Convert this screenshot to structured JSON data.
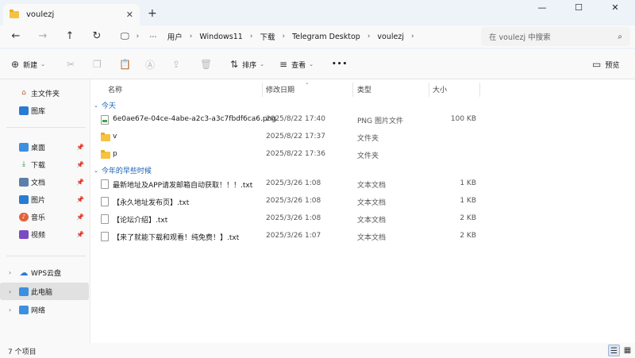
{
  "window": {
    "tab_title": "voulezj",
    "tab_close": "✕",
    "new_tab": "+",
    "minimize": "—",
    "maximize": "☐",
    "close": "✕"
  },
  "address": {
    "crumbs": [
      "用户",
      "Windows11",
      "下载",
      "Telegram Desktop",
      "voulezj"
    ],
    "more": "⋯",
    "sep": "›",
    "search_placeholder": "在 voulezj 中搜索"
  },
  "toolbar": {
    "new_label": "新建",
    "sort_label": "排序",
    "view_label": "查看",
    "more_label": "•••",
    "preview_label": "预览"
  },
  "sidebar": {
    "items": [
      {
        "label": "主文件夹",
        "icon": "home-icon"
      },
      {
        "label": "图库",
        "icon": "gallery-icon"
      },
      {
        "label": "桌面",
        "icon": "desktop-icon",
        "pinned": true
      },
      {
        "label": "下载",
        "icon": "download-icon",
        "pinned": true
      },
      {
        "label": "文档",
        "icon": "document-icon",
        "pinned": true
      },
      {
        "label": "图片",
        "icon": "pictures-icon",
        "pinned": true
      },
      {
        "label": "音乐",
        "icon": "music-icon",
        "pinned": true
      },
      {
        "label": "视频",
        "icon": "video-icon",
        "pinned": true
      },
      {
        "label": "WPS云盘",
        "icon": "cloud-icon"
      },
      {
        "label": "此电脑",
        "icon": "computer-icon",
        "selected": true
      },
      {
        "label": "网络",
        "icon": "network-icon"
      }
    ]
  },
  "columns": {
    "name": "名称",
    "date": "修改日期",
    "type": "类型",
    "size": "大小"
  },
  "groups": [
    {
      "label": "今天",
      "files": [
        {
          "name": "6e0ae67e-04ce-4abe-a2c3-a3c7fbdf6ca6.png",
          "date": "2025/8/22 17:40",
          "type": "PNG 图片文件",
          "size": "100 KB",
          "kind": "png"
        },
        {
          "name": "v",
          "date": "2025/8/22 17:37",
          "type": "文件夹",
          "size": "",
          "kind": "dir"
        },
        {
          "name": "p",
          "date": "2025/8/22 17:36",
          "type": "文件夹",
          "size": "",
          "kind": "dir"
        }
      ]
    },
    {
      "label": "今年的早些时候",
      "files": [
        {
          "name": "最新地址及APP请发邮箱自动获取！！！.txt",
          "date": "2025/3/26 1:08",
          "type": "文本文档",
          "size": "1 KB",
          "kind": "txt"
        },
        {
          "name": "【永久地址发布页】.txt",
          "date": "2025/3/26 1:08",
          "type": "文本文档",
          "size": "1 KB",
          "kind": "txt"
        },
        {
          "name": "【论坛介绍】.txt",
          "date": "2025/3/26 1:08",
          "type": "文本文档",
          "size": "2 KB",
          "kind": "txt"
        },
        {
          "name": "【来了就能下载和观看！纯免费！】.txt",
          "date": "2025/3/26 1:07",
          "type": "文本文档",
          "size": "2 KB",
          "kind": "txt"
        }
      ]
    }
  ],
  "status": {
    "count": "7 个项目"
  }
}
